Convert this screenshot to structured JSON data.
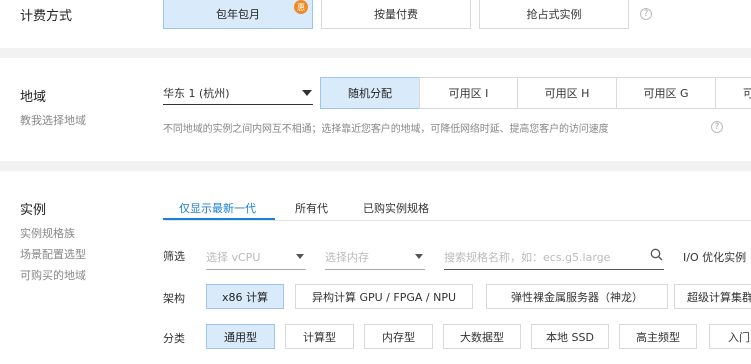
{
  "billing": {
    "label": "计费方式",
    "options": [
      "包年包月",
      "按量付费",
      "抢占式实例"
    ],
    "badge": "惠",
    "help": "?"
  },
  "region": {
    "label": "地域",
    "help_link": "教我选择地域",
    "selected": "华东 1 (杭州)",
    "zones": [
      "随机分配",
      "可用区 I",
      "可用区 H",
      "可用区 G",
      "可"
    ],
    "note": "不同地域的实例之间内网互不相通；选择靠近您客户的地域，可降低网络时延、提高您客户的访问速度",
    "help": "?"
  },
  "instance": {
    "label": "实例",
    "links": [
      "实例规格族",
      "场景配置选型",
      "可购买的地域"
    ],
    "tabs": [
      "仅显示最新一代",
      "所有代",
      "已购实例规格"
    ],
    "filter": {
      "label": "筛选",
      "vcpu_placeholder": "选择 vCPU",
      "memory_placeholder": "选择内存",
      "search_placeholder": "搜索规格名称，如：ecs.g5.large",
      "io_label": "I/O 优化实例"
    },
    "arch": {
      "label": "架构",
      "options": [
        "x86 计算",
        "异构计算 GPU / FPGA / NPU",
        "弹性裸金属服务器（神龙）",
        "超级计算集群"
      ]
    },
    "category": {
      "label": "分类",
      "options": [
        "通用型",
        "计算型",
        "内存型",
        "大数据型",
        "本地 SSD",
        "高主频型",
        "入门"
      ]
    }
  }
}
